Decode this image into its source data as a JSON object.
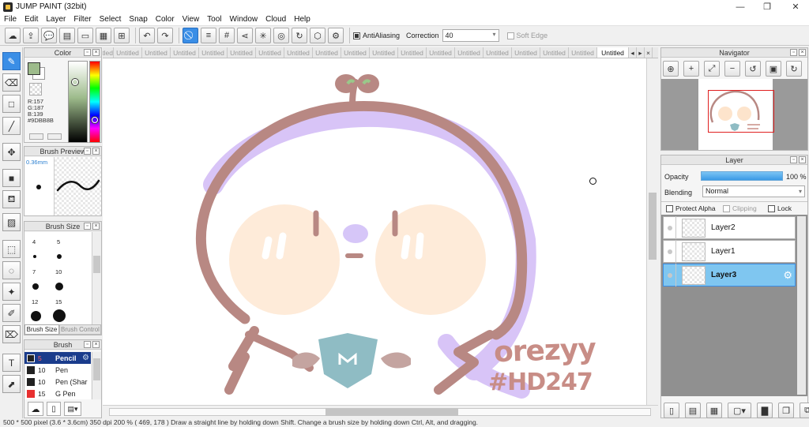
{
  "window": {
    "title": "JUMP PAINT (32bit)",
    "minimize": "—",
    "maximize": "❐",
    "close": "✕"
  },
  "menu": [
    "File",
    "Edit",
    "Layer",
    "Filter",
    "Select",
    "Snap",
    "Color",
    "View",
    "Tool",
    "Window",
    "Cloud",
    "Help"
  ],
  "toolbar": {
    "antialiasing_label": "AntiAliasing",
    "correction_label": "Correction",
    "correction_value": "40",
    "soft_edge_label": "Soft Edge"
  },
  "color_panel": {
    "title": "Color",
    "r": "R:157",
    "g": "G:187",
    "b": "B:139",
    "hex": "#9DBB8B",
    "primary_color": "#9DBB8B"
  },
  "brush_preview": {
    "title": "Brush Preview",
    "size": "0.36mm"
  },
  "brush_size": {
    "title": "Brush Size",
    "sizes": [
      "4",
      "5",
      "7",
      "10",
      "12",
      "15"
    ],
    "tab_active": "Brush Size",
    "tab_inactive": "Brush Control"
  },
  "brush_panel": {
    "title": "Brush",
    "items": [
      {
        "size": "5",
        "name": "Pencil",
        "color": "#222222",
        "selected": true
      },
      {
        "size": "10",
        "name": "Pen",
        "color": "#222222",
        "selected": false
      },
      {
        "size": "10",
        "name": "Pen (Shar",
        "color": "#222222",
        "selected": false
      },
      {
        "size": "15",
        "name": "G Pen",
        "color": "#e83030",
        "selected": false
      }
    ]
  },
  "tabs": [
    "Untitled",
    "Untitled",
    "Untitled",
    "Untitled",
    "Untitled",
    "Untitled",
    "Untitled",
    "Untitled",
    "Untitled",
    "Untitled",
    "Untitled",
    "Untitled",
    "Untitled",
    "Untitled",
    "Untitled",
    "Untitled",
    "Untitled",
    "Untitled",
    "Untitled"
  ],
  "active_tab": "Untitled",
  "artwork": {
    "signature_line1": "orezyy",
    "signature_line2": "#HD247",
    "badge_letter": "M"
  },
  "navigator": {
    "title": "Navigator"
  },
  "layer_panel": {
    "title": "Layer",
    "opacity_label": "Opacity",
    "opacity_value": "100 %",
    "opacity_fraction": 1.0,
    "blending_label": "Blending",
    "blending_value": "Normal",
    "protect_alpha_label": "Protect Alpha",
    "clipping_label": "Clipping",
    "lock_label": "Lock",
    "layers": [
      {
        "name": "Layer2",
        "selected": false
      },
      {
        "name": "Layer1",
        "selected": false
      },
      {
        "name": "Layer3",
        "selected": true
      }
    ]
  },
  "status": "500 * 500 pixel   (3.6 * 3.6cm)   350 dpi   200 %   ( 469, 178 )   Draw a straight line by holding down Shift. Change a brush size by holding down Ctrl, Alt, and dragging."
}
